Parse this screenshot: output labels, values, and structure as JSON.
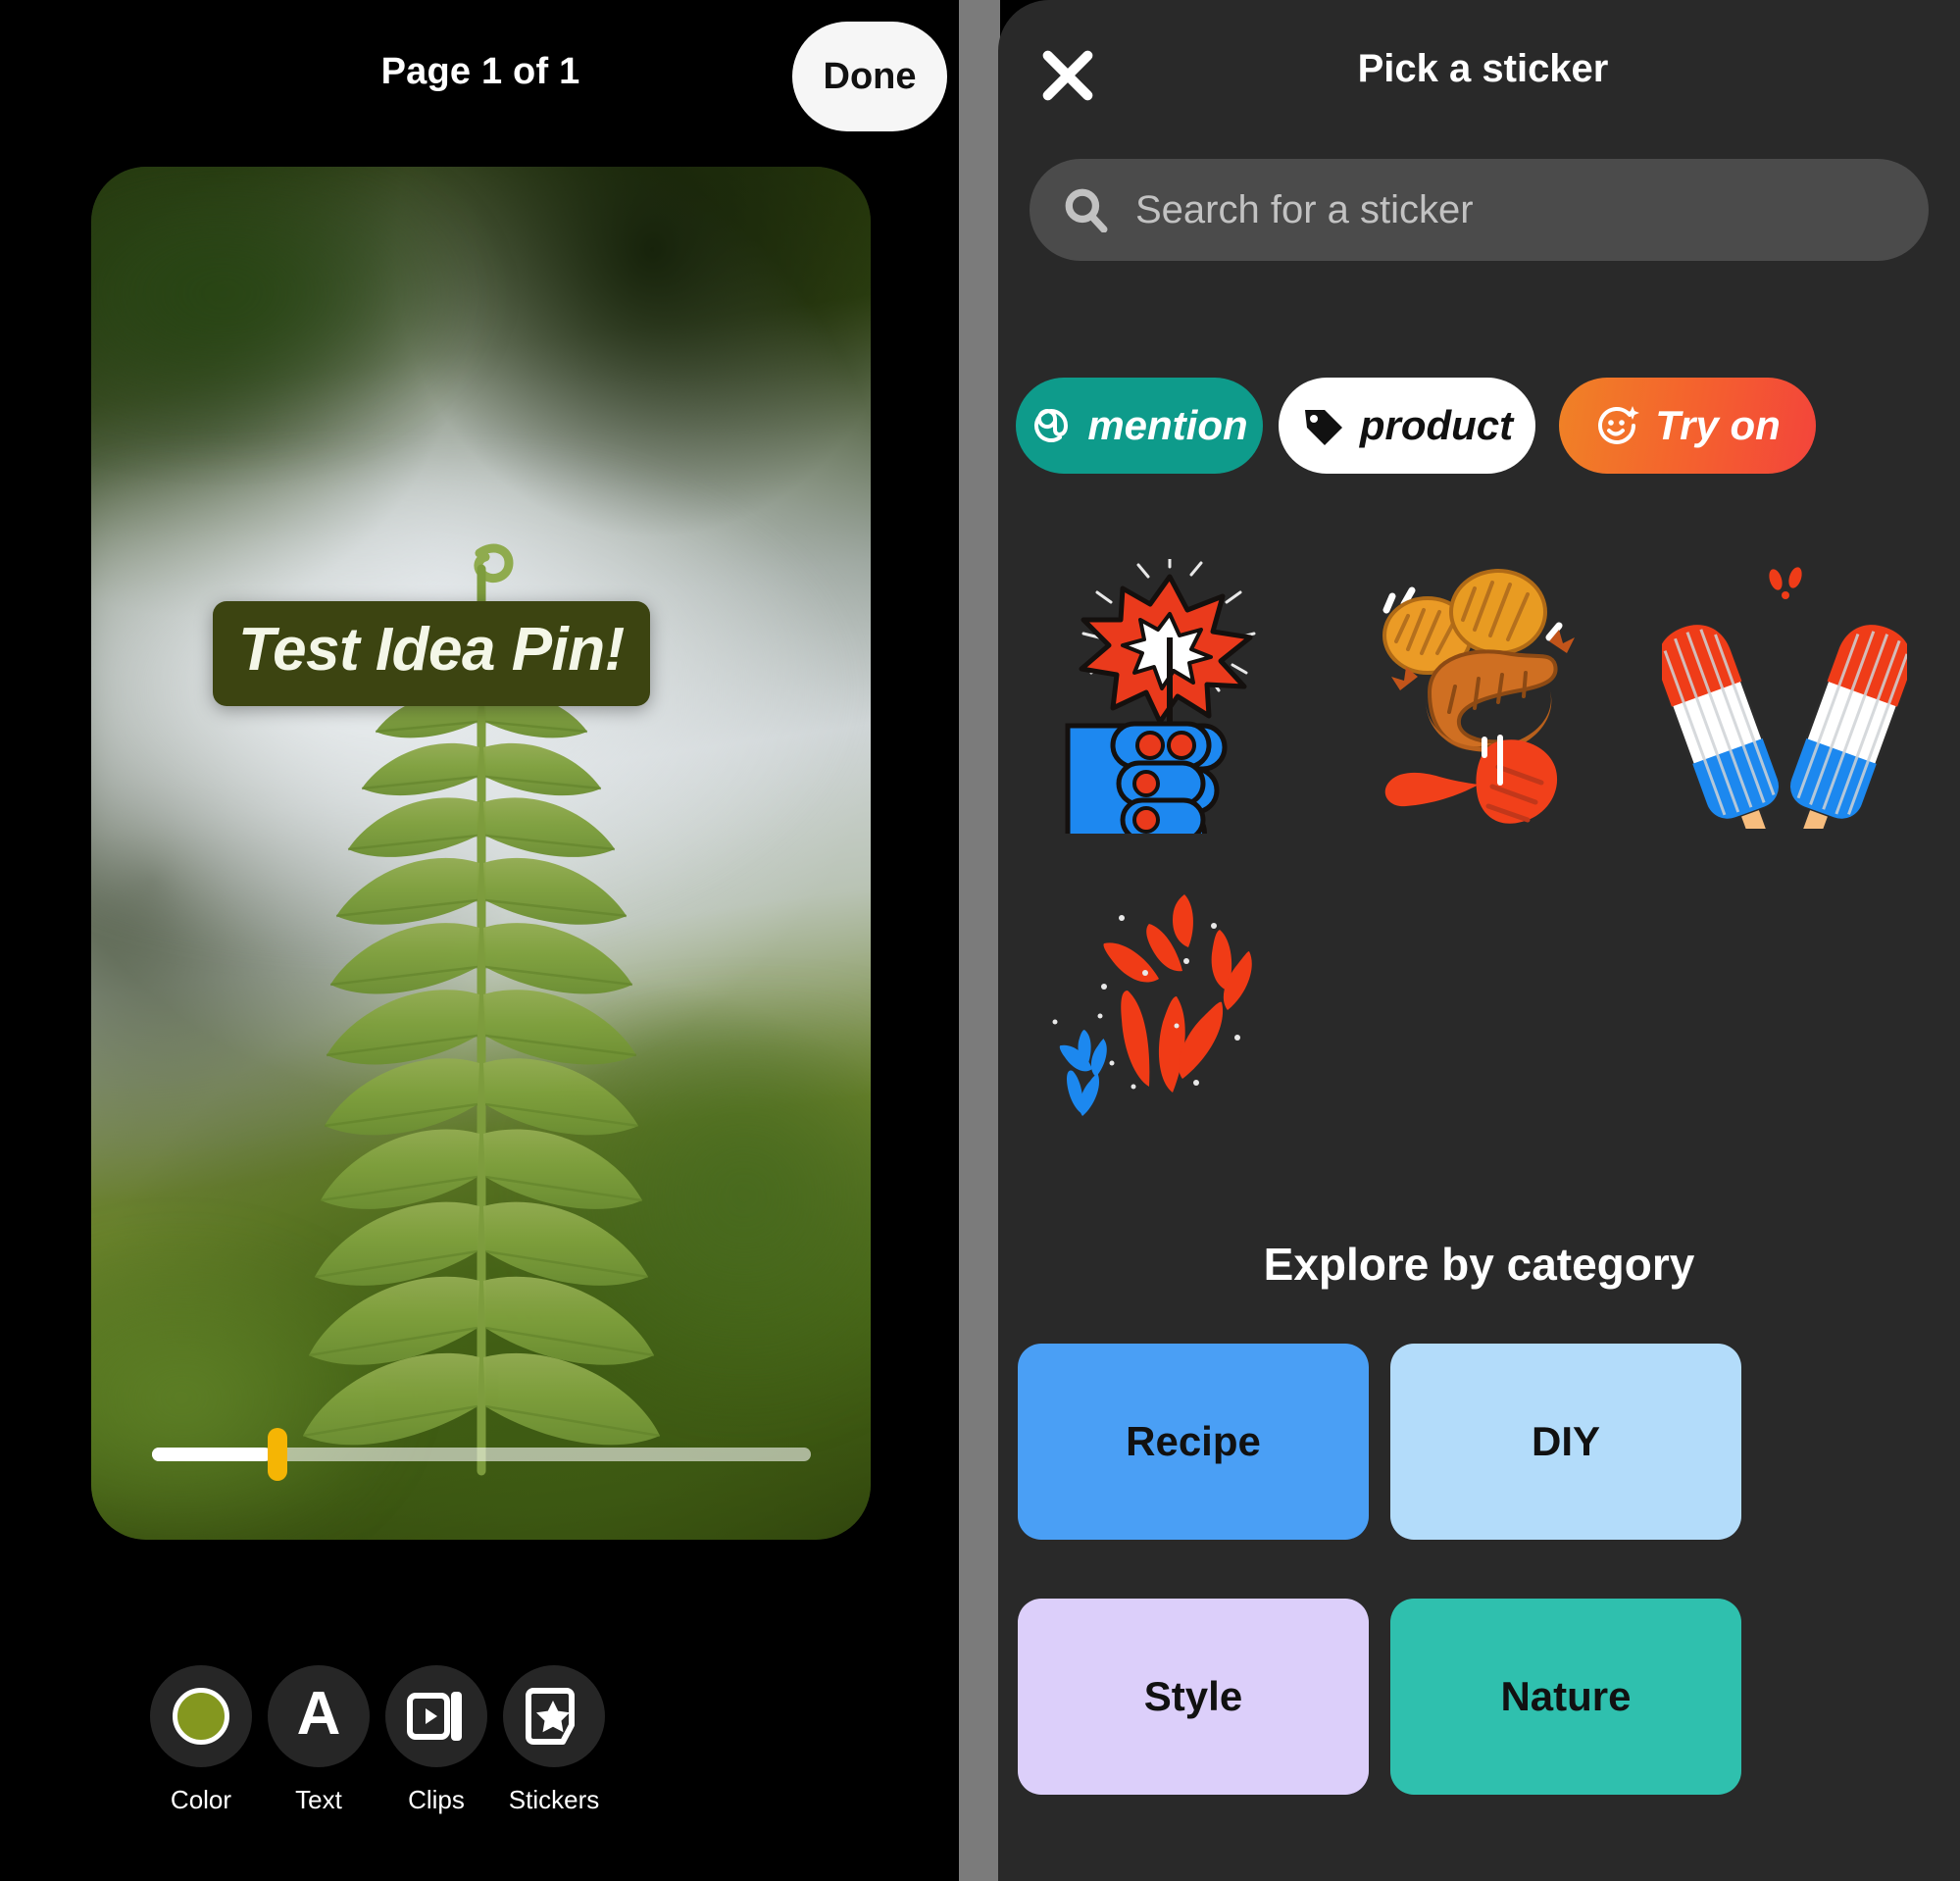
{
  "editor": {
    "page_indicator": "Page 1 of 1",
    "done_label": "Done",
    "text_sticker": "Test Idea Pin!",
    "scrubber": {
      "progress_percent": 18,
      "handle_color": "#f5b504"
    },
    "photo_description": "fern-frond-snow-photo",
    "tools": [
      {
        "label": "Color",
        "icon": "color-swatch-icon",
        "swatch_color": "#84971f"
      },
      {
        "label": "Text",
        "icon": "letter-a-icon"
      },
      {
        "label": "Clips",
        "icon": "clips-icon"
      },
      {
        "label": "Stickers",
        "icon": "sticker-star-icon"
      }
    ]
  },
  "picker": {
    "title": "Pick a sticker",
    "close_icon": "close-icon",
    "search": {
      "placeholder": "Search for a sticker",
      "value": "",
      "icon": "search-icon"
    },
    "pills": [
      {
        "label": "mention",
        "icon": "at-sign-icon",
        "bg": "#0e9b8b",
        "fg": "#ffffff"
      },
      {
        "label": "product",
        "icon": "price-tag-icon",
        "bg": "#ffffff",
        "fg": "#111111"
      },
      {
        "label": "Try on",
        "icon": "smiley-sparkle-icon",
        "bg": "#f4642d",
        "fg": "#ffffff"
      }
    ],
    "stickers": [
      {
        "name": "sparkler-in-hand-sticker"
      },
      {
        "name": "bbq-spatula-sausage-sticker"
      },
      {
        "name": "red-white-blue-popsicles-sticker"
      },
      {
        "name": "fireworks-sticker"
      }
    ],
    "explore_title": "Explore by category",
    "categories": [
      {
        "label": "Recipe",
        "color": "#4a9ff5"
      },
      {
        "label": "DIY",
        "color": "#b3dcfa"
      },
      {
        "label": "Style",
        "color": "#dccffa"
      },
      {
        "label": "Nature",
        "color": "#2fc0ae"
      }
    ]
  },
  "theme": {
    "app_bg": "#000000",
    "panel_bg": "#292929",
    "divider": "#7b7b7b",
    "search_bg": "#4b4b4b",
    "tool_circle_bg": "#262626",
    "text_sticker_bg": "#3c4411"
  }
}
